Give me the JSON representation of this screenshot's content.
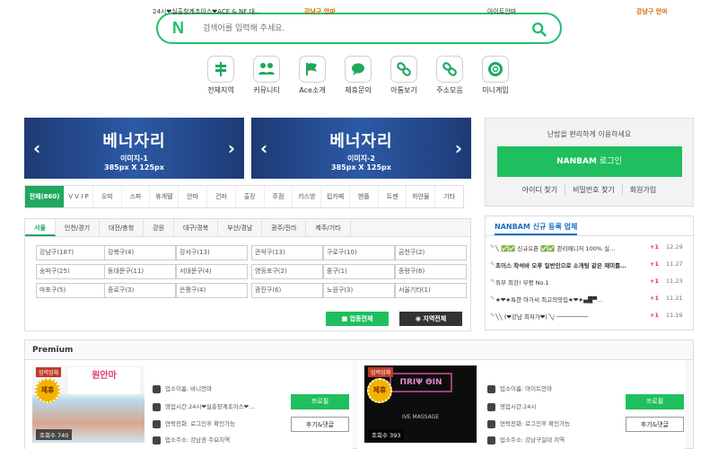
{
  "search": {
    "logo": "N",
    "placeholder": "검색어를 입력해 주세요."
  },
  "quick_menu": [
    {
      "label": "전체지역",
      "icon": "signpost-icon"
    },
    {
      "label": "커뮤니티",
      "icon": "people-icon"
    },
    {
      "label": "Ace소개",
      "icon": "flag-icon"
    },
    {
      "label": "제휴문의",
      "icon": "chat-icon"
    },
    {
      "label": "아톰보기",
      "icon": "link-icon"
    },
    {
      "label": "주소모음",
      "icon": "link-icon"
    },
    {
      "label": "미니게임",
      "icon": "lifebuoy-icon"
    }
  ],
  "banners": [
    {
      "title": "베너자리",
      "sub": "이미지-1",
      "size": "385px X 125px"
    },
    {
      "title": "베너자리",
      "sub": "이미지-2",
      "size": "385px X 125px"
    }
  ],
  "category_tabs": [
    "전체(860)",
    "V V I P",
    "오피",
    "스파",
    "휴게텔",
    "안마",
    "건마",
    "출장",
    "주점",
    "키스방",
    "립카페",
    "핸플",
    "트젠",
    "하얀물",
    "기타"
  ],
  "region_tabs": [
    "서울",
    "인천/경기",
    "대전/충청",
    "강원",
    "대구/경북",
    "부산/경남",
    "광주/전라",
    "제주/기타"
  ],
  "region_cells": [
    [
      "강남구(187)",
      "강북구(4)",
      "강서구(13)",
      "관악구(13)",
      "구로구(10)",
      "금천구(2)"
    ],
    [
      "송파구(25)",
      "동대문구(11)",
      "서대문구(4)",
      "영등포구(2)",
      "중구(1)",
      "종랑구(6)"
    ],
    [
      "마포구(5)",
      "종로구(3)",
      "은평구(4)",
      "광진구(6)",
      "노원구(3)",
      "서울기타(1)"
    ]
  ],
  "region_buttons": {
    "all_biz": "업종전체",
    "all_region": "지역전체"
  },
  "login": {
    "message": "난밤을 편리하게 이용하세요",
    "brand": "NANBAM",
    "button": "로그인",
    "links": [
      "아이디 찾기",
      "비밀번호 찾기",
      "회원가입"
    ]
  },
  "news": {
    "title": "NANBAM 신규 등록 업체",
    "items": [
      {
        "text": "╲ ✅✅ 신규오픈 ✅✅ 관리매니저 100% 실…",
        "plus": "+1",
        "date": "12.29"
      },
      {
        "text": "초이스 착석바 오후 일반인으로 소개팅 같은 재미를…",
        "plus": "+1",
        "date": "11.27"
      },
      {
        "text": "외부 최강! 부평 No.1",
        "plus": "+1",
        "date": "11.23"
      },
      {
        "text": "★❤★특한 아가씨 최고의맛집★❤★▄█▀…",
        "plus": "+1",
        "date": "11.21"
      },
      {
        "text": "╲╲ (❤강남 최저가❤) ╲/ ─────────",
        "plus": "+1",
        "date": "11.19"
      }
    ]
  },
  "premium": {
    "title": "Premium",
    "cards": [
      {
        "badge": "업력업체",
        "seal": "제휴",
        "views": "조회수 740",
        "title": "24시❤실출창계초이스❤ACE & NF 대…",
        "location": "강남구 안마",
        "shop": "업소이름: 바니안마",
        "hours": "영업시간:24시❤실출창계초이스❤…",
        "contact": "연락전화: 로그인후 확인가능",
        "address": "업소주소: 강남권 주요지역",
        "profile": "프로필",
        "review": "후기&댓글",
        "img_text": "원안마"
      },
      {
        "badge": "업력업체",
        "seal": "제휴",
        "views": "조회수 393",
        "title": "아이트안마",
        "location": "강남구 안마",
        "shop": "업소이름: 아이트안마",
        "hours": "영업시간:24시",
        "contact": "연락전화: 로그인후 확인가능",
        "address": "업소주소: 강남구일대 지역",
        "profile": "프로필",
        "review": "후기&댓글",
        "img_text": "IVE MASSAGE"
      }
    ]
  },
  "colors": {
    "brand_green": "#1fbf5f",
    "banner_blue": "#2c5aa6",
    "accent_red": "#d33"
  }
}
